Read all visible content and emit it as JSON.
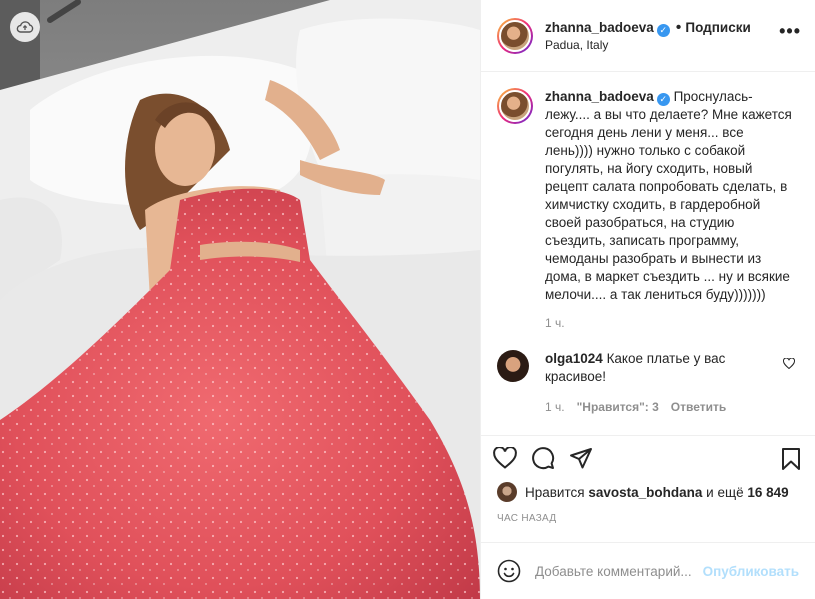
{
  "header": {
    "username": "zhanna_badoeva",
    "separator": "•",
    "follow_label": "Подписки",
    "location": "Padua, Italy",
    "more_label": "•••"
  },
  "caption": {
    "username": "zhanna_badoeva",
    "text": "Проснулась-лежу.... а вы что делаете? Мне кажется сегодня день лени у меня... все лень)))) нужно только с собакой погулять, на йогу сходить, новый рецепт салата попробовать сделать, в химчистку сходить, в гардеробной своей разобраться, на студию съездить, записать программу, чемоданы разобрать и вынести из дома, в маркет съездить ... ну и всякие мелочи.... а так лениться буду)))))))",
    "time": "1 ч."
  },
  "comment": {
    "username": "olga1024",
    "text": "Какое платье у вас красивое!",
    "time": "1 ч.",
    "likes": "\"Нравится\": 3",
    "reply_label": "Ответить"
  },
  "likes": {
    "prefix": "Нравится",
    "user": "savosta_bohdana",
    "middle": "и ещё",
    "count": "16 849"
  },
  "posted_ago": "ЧАС НАЗАД",
  "add_comment": {
    "placeholder": "Добавьте комментарий...",
    "publish_label": "Опубликовать"
  },
  "icons": {
    "cloud": "cloud-upload-icon",
    "heart": "heart-icon",
    "comment": "comment-icon",
    "share": "share-icon",
    "save": "bookmark-icon",
    "emoji": "emoji-icon"
  },
  "colors": {
    "accent": "#3897f0",
    "publish_disabled": "#b2dffc",
    "dress": "#e0505a"
  }
}
